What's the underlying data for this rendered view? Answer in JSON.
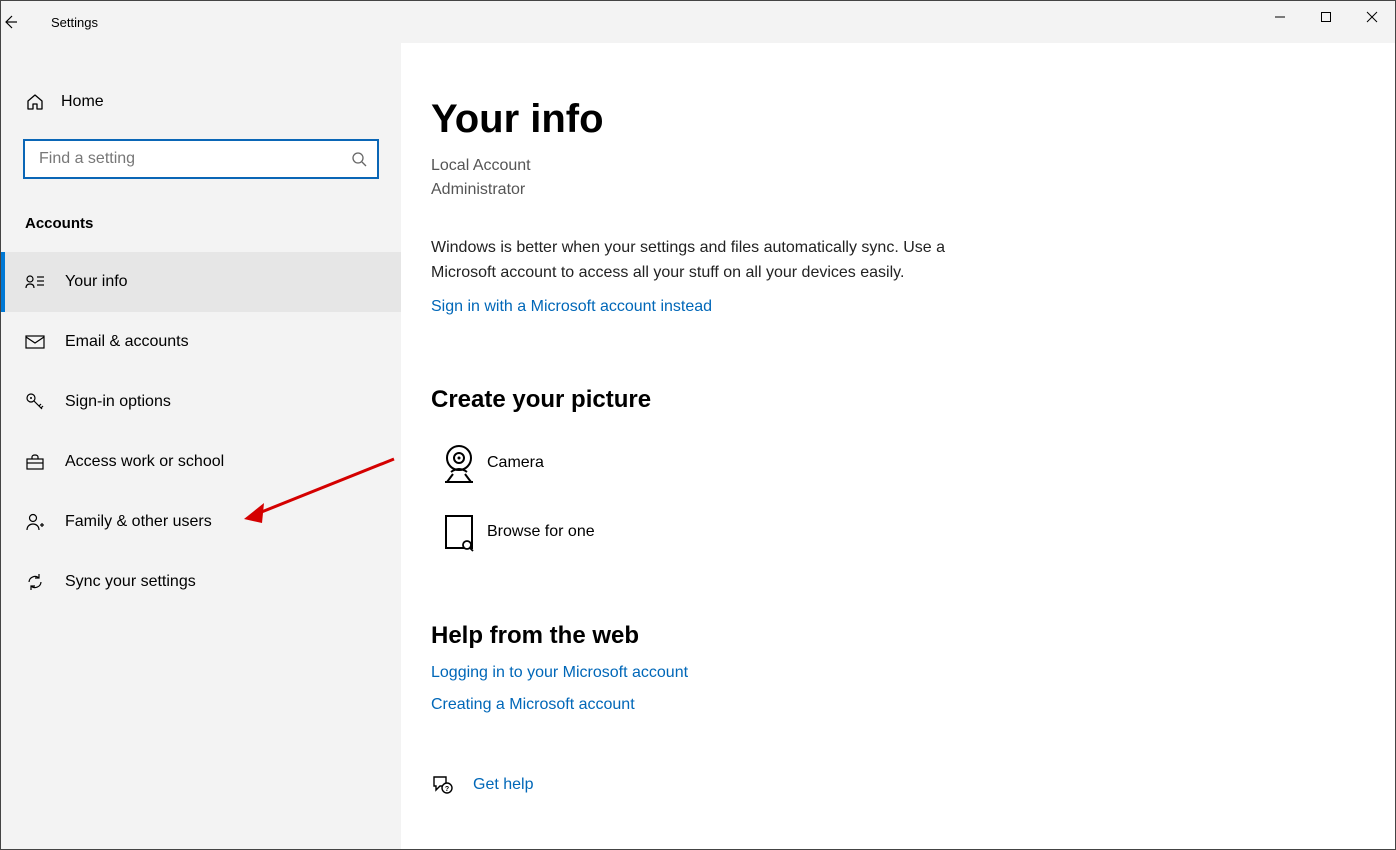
{
  "window": {
    "title": "Settings"
  },
  "sidebar": {
    "home": "Home",
    "search_placeholder": "Find a setting",
    "category": "Accounts",
    "items": [
      {
        "label": "Your info"
      },
      {
        "label": "Email & accounts"
      },
      {
        "label": "Sign-in options"
      },
      {
        "label": "Access work or school"
      },
      {
        "label": "Family & other users"
      },
      {
        "label": "Sync your settings"
      }
    ]
  },
  "main": {
    "title": "Your info",
    "account_type": "Local Account",
    "role": "Administrator",
    "desc": "Windows is better when your settings and files automatically sync. Use a Microsoft account to access all your stuff on all your devices easily.",
    "signin_link": "Sign in with a Microsoft account instead",
    "picture_heading": "Create your picture",
    "camera": "Camera",
    "browse": "Browse for one",
    "help_heading": "Help from the web",
    "help_links": [
      "Logging in to your Microsoft account",
      "Creating a Microsoft account"
    ],
    "get_help": "Get help"
  }
}
